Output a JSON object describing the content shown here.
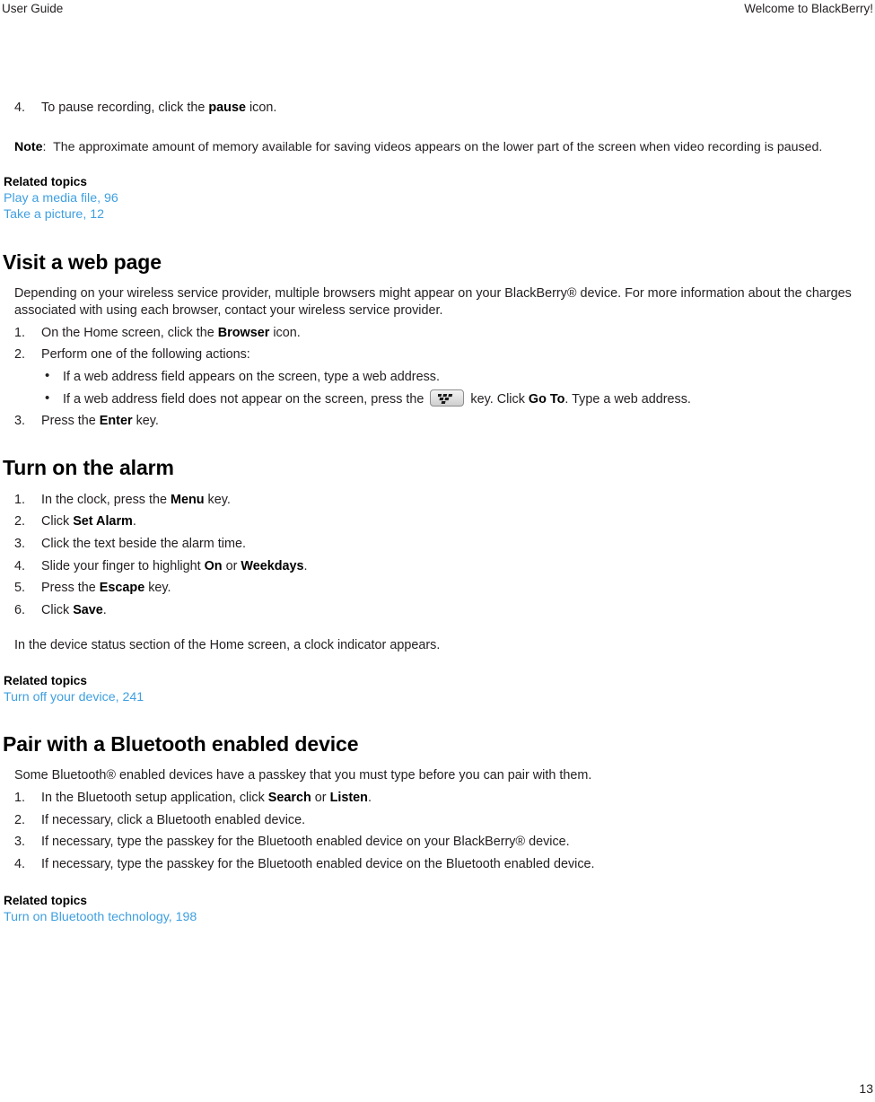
{
  "header": {
    "left": "User Guide",
    "right": "Welcome to BlackBerry!"
  },
  "colors": {
    "link": "#3f9fe0",
    "text": "#231f20",
    "heading": "#000000",
    "key_border": "#8c8c8c"
  },
  "footer": {
    "page_number": "13"
  },
  "video_section": {
    "step4": {
      "num": "4.",
      "text_before": "To pause recording, click the ",
      "bold": "pause",
      "text_after": " icon."
    },
    "note": {
      "label": "Note",
      "colon": ":",
      "text": "The approximate amount of memory available for saving videos appears on the lower part of the screen when video recording is paused."
    },
    "related": {
      "title": "Related topics",
      "links": [
        "Play a media file, 96",
        "Take a picture, 12"
      ]
    }
  },
  "web_section": {
    "heading": "Visit a web page",
    "intro": "Depending on your wireless service provider, multiple browsers might appear on your BlackBerry® device. For more information about the charges associated with using each browser, contact your wireless service provider.",
    "steps": [
      {
        "num": "1.",
        "parts": [
          {
            "t": "On the Home screen, click the ",
            "b": false
          },
          {
            "t": "Browser",
            "b": true
          },
          {
            "t": " icon.",
            "b": false
          }
        ]
      },
      {
        "num": "2.",
        "parts": [
          {
            "t": "Perform one of the following actions:",
            "b": false
          }
        ],
        "sublist": [
          {
            "bullet": "•",
            "parts": [
              {
                "t": "If a web address field appears on the screen, type a web address.",
                "b": false
              }
            ]
          },
          {
            "bullet": "•",
            "parts": [
              {
                "t": "If a web address field does not appear on the screen, press the ",
                "b": false
              },
              {
                "key": "blackberry-menu-key"
              },
              {
                "t": " key. Click ",
                "b": false
              },
              {
                "t": "Go To",
                "b": true
              },
              {
                "t": ". Type a web address.",
                "b": false
              }
            ]
          }
        ]
      },
      {
        "num": "3.",
        "parts": [
          {
            "t": "Press the ",
            "b": false
          },
          {
            "t": "Enter",
            "b": true
          },
          {
            "t": " key.",
            "b": false
          }
        ]
      }
    ]
  },
  "alarm_section": {
    "heading": "Turn on the alarm",
    "steps": [
      {
        "num": "1.",
        "parts": [
          {
            "t": "In the clock, press the ",
            "b": false
          },
          {
            "t": "Menu",
            "b": true
          },
          {
            "t": " key.",
            "b": false
          }
        ]
      },
      {
        "num": "2.",
        "parts": [
          {
            "t": "Click ",
            "b": false
          },
          {
            "t": "Set Alarm",
            "b": true
          },
          {
            "t": ".",
            "b": false
          }
        ]
      },
      {
        "num": "3.",
        "parts": [
          {
            "t": "Click the text beside the alarm time.",
            "b": false
          }
        ]
      },
      {
        "num": "4.",
        "parts": [
          {
            "t": "Slide your finger to highlight ",
            "b": false
          },
          {
            "t": "On",
            "b": true
          },
          {
            "t": " or ",
            "b": false
          },
          {
            "t": "Weekdays",
            "b": true
          },
          {
            "t": ".",
            "b": false
          }
        ]
      },
      {
        "num": "5.",
        "parts": [
          {
            "t": "Press the ",
            "b": false
          },
          {
            "t": "Escape",
            "b": true
          },
          {
            "t": " key.",
            "b": false
          }
        ]
      },
      {
        "num": "6.",
        "parts": [
          {
            "t": "Click ",
            "b": false
          },
          {
            "t": "Save",
            "b": true
          },
          {
            "t": ".",
            "b": false
          }
        ]
      }
    ],
    "after_text": "In the device status section of the Home screen, a clock indicator appears.",
    "related": {
      "title": "Related topics",
      "links": [
        "Turn off your device, 241"
      ]
    }
  },
  "bluetooth_section": {
    "heading": "Pair with a Bluetooth enabled device",
    "intro": "Some Bluetooth® enabled devices have a passkey that you must type before you can pair with them.",
    "steps": [
      {
        "num": "1.",
        "parts": [
          {
            "t": "In the Bluetooth setup application, click ",
            "b": false
          },
          {
            "t": "Search",
            "b": true
          },
          {
            "t": " or ",
            "b": false
          },
          {
            "t": "Listen",
            "b": true
          },
          {
            "t": ".",
            "b": false
          }
        ]
      },
      {
        "num": "2.",
        "parts": [
          {
            "t": "If necessary, click a Bluetooth enabled device.",
            "b": false
          }
        ]
      },
      {
        "num": "3.",
        "parts": [
          {
            "t": "If necessary, type the passkey for the Bluetooth enabled device on your BlackBerry® device.",
            "b": false
          }
        ]
      },
      {
        "num": "4.",
        "parts": [
          {
            "t": "If necessary, type the passkey for the Bluetooth enabled device on the Bluetooth enabled device.",
            "b": false
          }
        ]
      }
    ],
    "related": {
      "title": "Related topics",
      "links": [
        "Turn on Bluetooth technology, 198"
      ]
    }
  }
}
